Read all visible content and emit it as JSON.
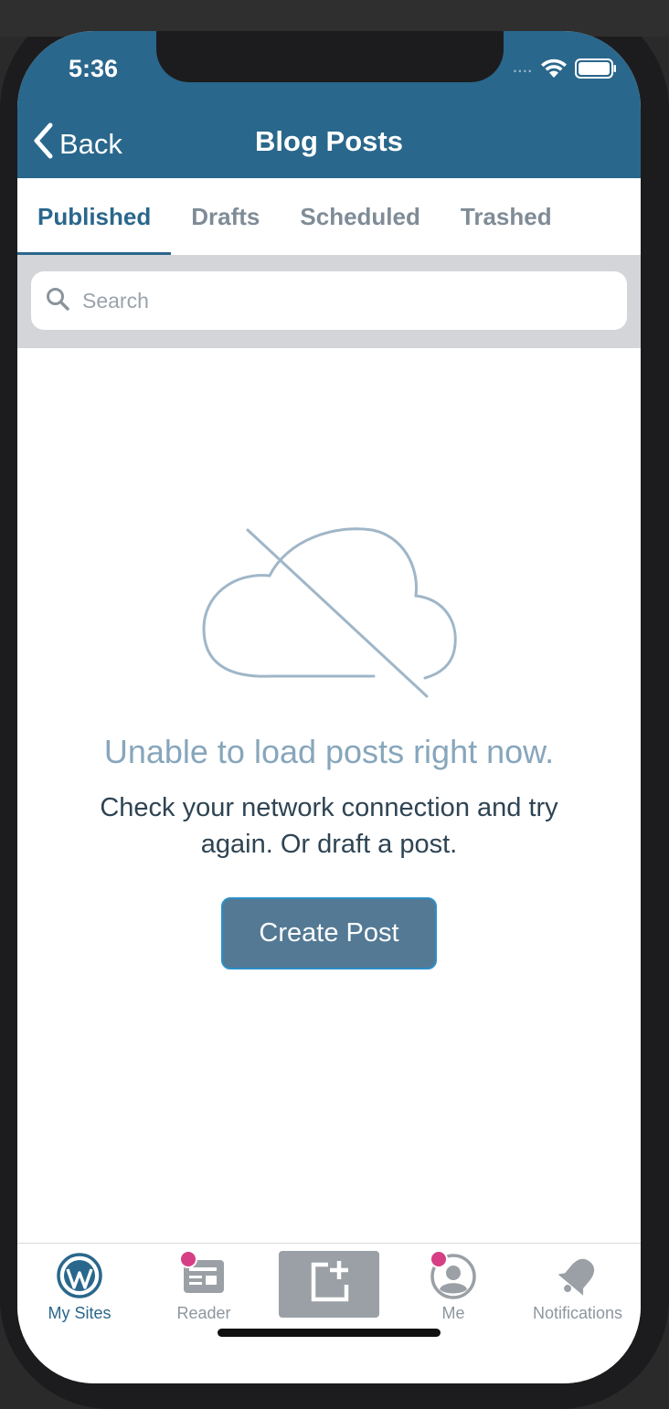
{
  "status_bar": {
    "time": "5:36",
    "signal": "....",
    "wifi_icon": "wifi-icon",
    "battery_icon": "battery-icon"
  },
  "header": {
    "back_label": "Back",
    "title": "Blog Posts",
    "color": "#2a678c"
  },
  "tabs": [
    {
      "label": "Published",
      "active": true
    },
    {
      "label": "Drafts",
      "active": false
    },
    {
      "label": "Scheduled",
      "active": false
    },
    {
      "label": "Trashed",
      "active": false
    }
  ],
  "search": {
    "placeholder": "Search"
  },
  "empty_state": {
    "icon": "cloud-offline-icon",
    "title": "Unable to load posts right now.",
    "message": "Check your network connection and try again. Or draft a post.",
    "button_label": "Create Post"
  },
  "bottom_tabs": [
    {
      "label": "My Sites",
      "icon": "wordpress-icon",
      "active": true,
      "badge": false
    },
    {
      "label": "Reader",
      "icon": "reader-icon",
      "active": false,
      "badge": true
    },
    {
      "label": "",
      "icon": "compose-icon",
      "active": false,
      "badge": false
    },
    {
      "label": "Me",
      "icon": "profile-icon",
      "active": false,
      "badge": true
    },
    {
      "label": "Notifications",
      "icon": "bell-icon",
      "active": false,
      "badge": false
    }
  ],
  "colors": {
    "accent": "#2a678c",
    "badge": "#d63f83",
    "button": "#537994",
    "muted_title": "#87a6bc"
  }
}
